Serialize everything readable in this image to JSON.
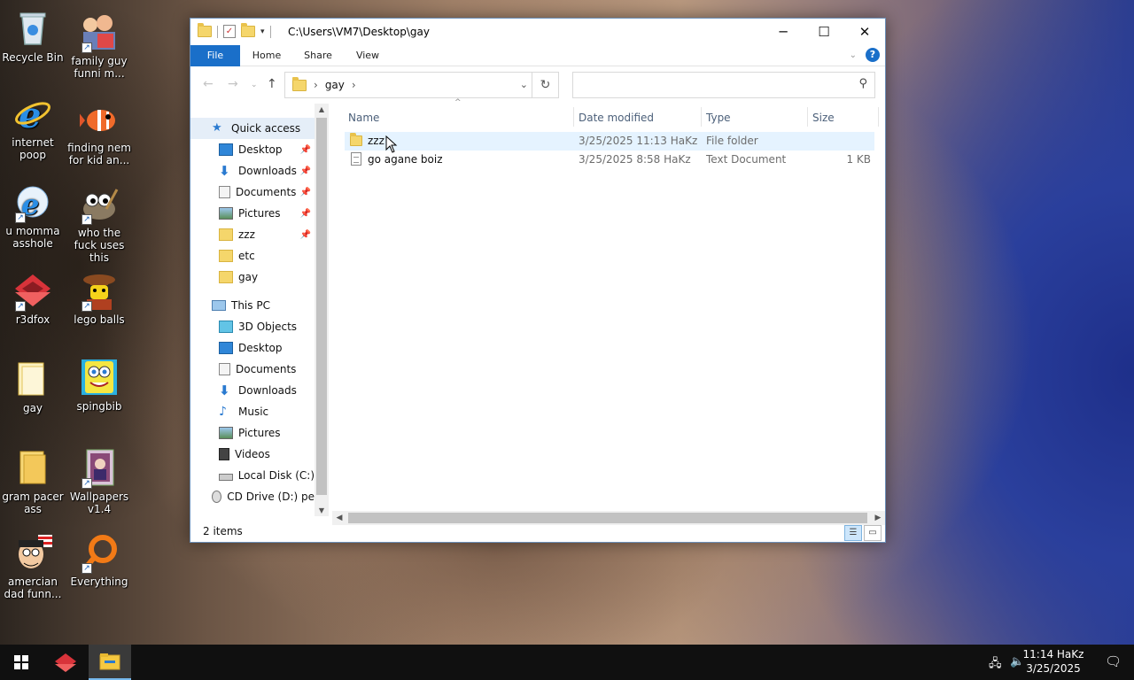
{
  "desktop": {
    "icons": [
      {
        "label": "Recycle Bin"
      },
      {
        "label": "family guy funni m..."
      },
      {
        "label": "internet poop"
      },
      {
        "label": "finding nem for kid an..."
      },
      {
        "label": "u momma asshole"
      },
      {
        "label": "who the fuck uses this"
      },
      {
        "label": "r3dfox"
      },
      {
        "label": "lego balls"
      },
      {
        "label": "gay"
      },
      {
        "label": "spingbib"
      },
      {
        "label": "gram pacer ass"
      },
      {
        "label": "Wallpapers v1.4"
      },
      {
        "label": "amercian dad funn..."
      },
      {
        "label": "Everything"
      }
    ]
  },
  "explorer": {
    "title": "C:\\Users\\VM7\\Desktop\\gay",
    "ribbon_tabs": [
      "File",
      "Home",
      "Share",
      "View"
    ],
    "address": {
      "crumb": "gay",
      "search_placeholder": ""
    },
    "nav": {
      "quick_access": "Quick access",
      "quick_items": [
        "Desktop",
        "Downloads",
        "Documents",
        "Pictures",
        "zzz",
        "etc",
        "gay"
      ],
      "this_pc": "This PC",
      "pc_items": [
        "3D Objects",
        "Desktop",
        "Documents",
        "Downloads",
        "Music",
        "Pictures",
        "Videos",
        "Local Disk (C:)",
        "CD Drive (D:) pe"
      ]
    },
    "columns": [
      "Name",
      "Date modified",
      "Type",
      "Size"
    ],
    "files": [
      {
        "name": "zzz",
        "date": "3/25/2025 11:13 HaKz",
        "type": "File folder",
        "size": "",
        "icon": "folder-icon",
        "selected": true
      },
      {
        "name": "go agane boiz",
        "date": "3/25/2025 8:58 HaKz",
        "type": "Text Document",
        "size": "1 KB",
        "icon": "text-file-icon",
        "selected": false
      }
    ],
    "status": "2 items"
  },
  "taskbar": {
    "time": "11:14 HaKz",
    "date": "3/25/2025"
  },
  "colors": {
    "accent": "#1a6fc9",
    "selection": "#e5f3ff",
    "folder": "#f5d66b"
  }
}
